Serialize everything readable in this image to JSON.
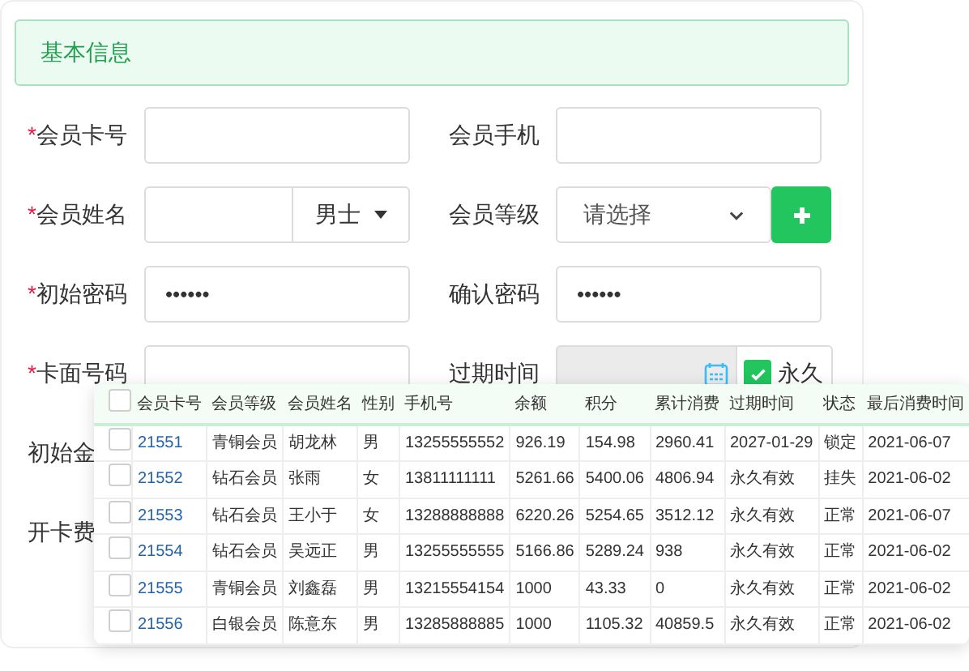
{
  "section_title": "基本信息",
  "form_rows": [
    {
      "left": {
        "label": "会员卡号",
        "required_mark": "*",
        "kind": "text"
      },
      "right": {
        "label": "会员手机",
        "kind": "text"
      }
    },
    {
      "left": {
        "label": "会员姓名",
        "required_mark": "*",
        "kind": "name-gender",
        "gender": "男士"
      },
      "right": {
        "label": "会员等级",
        "kind": "select-add",
        "placeholder": "请选择"
      }
    },
    {
      "left": {
        "label": "初始密码",
        "required_mark": "*",
        "kind": "password",
        "value": "••••••"
      },
      "right": {
        "label": "确认密码",
        "kind": "password",
        "value": "••••••"
      }
    },
    {
      "left": {
        "label": "卡面号码",
        "required_mark": "*",
        "kind": "text"
      },
      "right": {
        "label": "过期时间",
        "kind": "date-permanent",
        "permanent_label": "永久",
        "checked": true
      }
    },
    {
      "left": {
        "label": "初始金",
        "kind": "label-only"
      }
    },
    {
      "left": {
        "label": "开卡费",
        "kind": "label-only"
      }
    }
  ],
  "table": {
    "columns": [
      "会员卡号",
      "会员等级",
      "会员姓名",
      "性别",
      "手机号",
      "余额",
      "积分",
      "累计消费",
      "过期时间",
      "状态",
      "最后消费时间"
    ],
    "header_checked": false,
    "rows": [
      {
        "checked": false,
        "cells": [
          "21551",
          "青铜会员",
          "胡龙林",
          "男",
          "13255555552",
          "926.19",
          "154.98",
          "2960.41",
          "2027-01-29",
          "锁定",
          "2021-06-07"
        ]
      },
      {
        "checked": false,
        "cells": [
          "21552",
          "钻石会员",
          "张雨",
          "女",
          "13811111111",
          "5261.66",
          "5400.06",
          "4806.94",
          "永久有效",
          "挂失",
          "2021-06-02"
        ]
      },
      {
        "checked": false,
        "cells": [
          "21553",
          "钻石会员",
          "王小于",
          "女",
          "13288888888",
          "6220.26",
          "5254.65",
          "3512.12",
          "永久有效",
          "正常",
          "2021-06-07"
        ]
      },
      {
        "checked": false,
        "cells": [
          "21554",
          "钻石会员",
          "吴远正",
          "男",
          "13255555555",
          "5166.86",
          "5289.24",
          "938",
          "永久有效",
          "正常",
          "2021-06-02"
        ]
      },
      {
        "checked": false,
        "cells": [
          "21555",
          "青铜会员",
          "刘鑫磊",
          "男",
          "13215554154",
          "1000",
          "43.33",
          "0",
          "永久有效",
          "正常",
          "2021-06-02"
        ]
      },
      {
        "checked": false,
        "cells": [
          "21556",
          "白银会员",
          "陈意东",
          "男",
          "13285888885",
          "1000",
          "1105.32",
          "40859.5",
          "永久有效",
          "正常",
          "2021-06-02"
        ]
      }
    ]
  }
}
